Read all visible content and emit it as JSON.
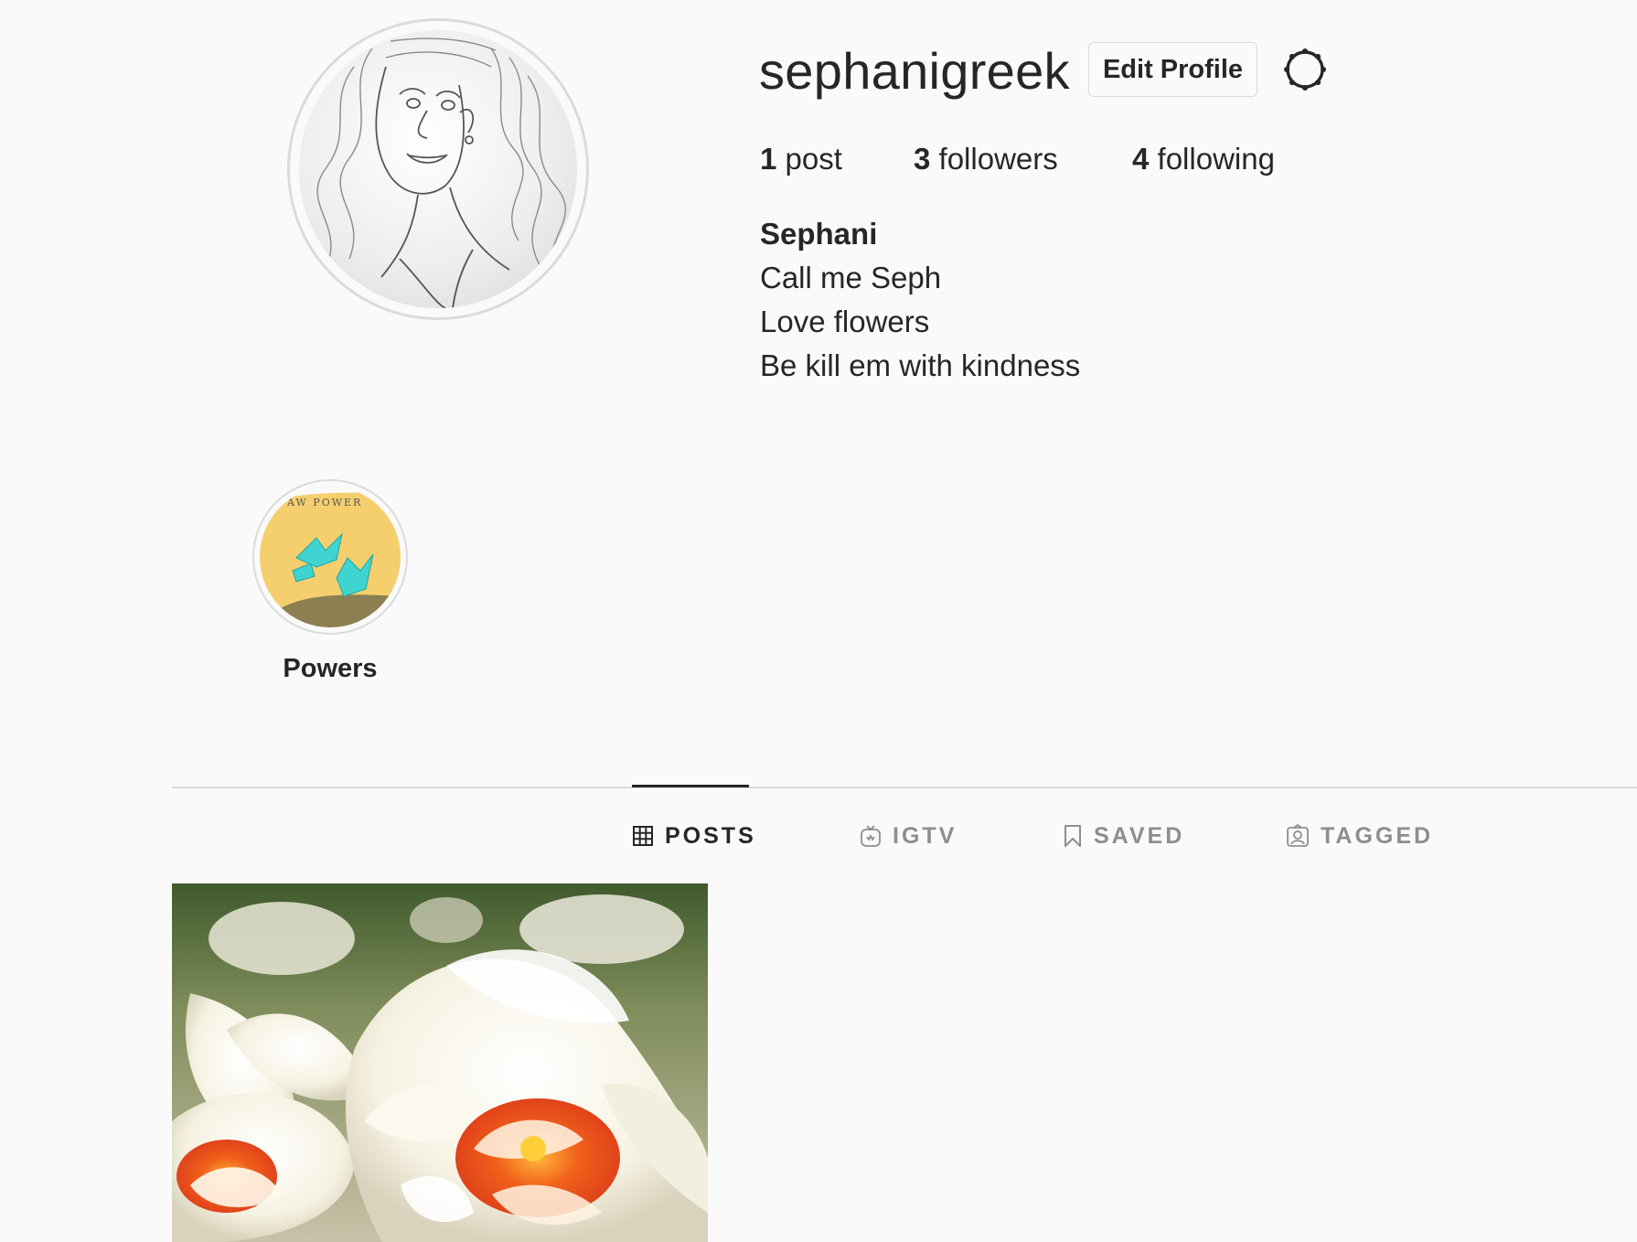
{
  "profile": {
    "username": "sephanigreek",
    "edit_profile_label": "Edit Profile",
    "settings_icon": "gear-icon",
    "stats": {
      "posts_count": "1",
      "posts_label": "post",
      "followers_count": "3",
      "followers_label": "followers",
      "following_count": "4",
      "following_label": "following"
    },
    "bio": {
      "full_name": "Sephani",
      "lines": [
        "Call me Seph",
        "Love flowers",
        "Be kill em with kindness"
      ]
    }
  },
  "highlights": [
    {
      "label": "Powers",
      "cover_text": "AW POWER"
    }
  ],
  "tabs": [
    {
      "label": "POSTS",
      "icon": "grid-icon",
      "active": true
    },
    {
      "label": "IGTV",
      "icon": "igtv-icon",
      "active": false
    },
    {
      "label": "SAVED",
      "icon": "bookmark-icon",
      "active": false
    },
    {
      "label": "TAGGED",
      "icon": "tagged-user-icon",
      "active": false
    }
  ],
  "posts": [
    {
      "subject": "white and orange daffodil flowers"
    }
  ],
  "colors": {
    "background": "#fafafa",
    "text": "#262626",
    "muted": "#8e8e8e",
    "border": "#dbdbdb"
  }
}
